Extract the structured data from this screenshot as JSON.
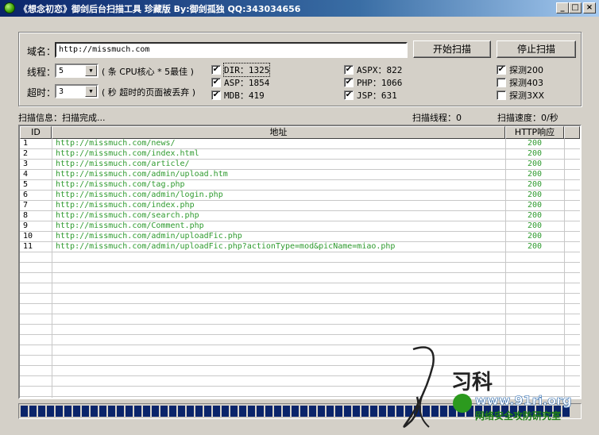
{
  "window": {
    "title": "《想念初恋》御剑后台扫描工具 珍藏版 By:御剑孤独 QQ:343034656",
    "minimize_glyph": "_",
    "maximize_glyph": "□",
    "close_glyph": "×"
  },
  "domain": {
    "label": "域名：",
    "value": "http://missmuch.com"
  },
  "buttons": {
    "start": "开始扫描",
    "stop": "停止扫描"
  },
  "threads": {
    "label": "线程：",
    "value": "5",
    "hint": "( 条 CPU核心 * 5最佳 )"
  },
  "timeout": {
    "label": "超时：",
    "value": "3",
    "hint": "( 秒 超时的页面被丢弃 )"
  },
  "checkboxes": [
    {
      "label": "DIR：1325",
      "checked": true
    },
    {
      "label": "ASP：1854",
      "checked": true
    },
    {
      "label": "MDB：419",
      "checked": true
    },
    {
      "label": "ASPX：822",
      "checked": true
    },
    {
      "label": "PHP：1066",
      "checked": true
    },
    {
      "label": "JSP：631",
      "checked": true
    },
    {
      "label": "探测200",
      "checked": true
    },
    {
      "label": "探测403",
      "checked": false
    },
    {
      "label": "探测3XX",
      "checked": false
    }
  ],
  "status": {
    "info": "扫描信息：扫描完成...",
    "threads": "扫描线程：0",
    "speed": "扫描速度：0/秒"
  },
  "table": {
    "headers": [
      "ID",
      "地址",
      "HTTP响应"
    ],
    "rows": [
      [
        "1",
        "http://missmuch.com/news/",
        "200"
      ],
      [
        "2",
        "http://missmuch.com/index.html",
        "200"
      ],
      [
        "3",
        "http://missmuch.com/article/",
        "200"
      ],
      [
        "4",
        "http://missmuch.com/admin/upload.htm",
        "200"
      ],
      [
        "5",
        "http://missmuch.com/tag.php",
        "200"
      ],
      [
        "6",
        "http://missmuch.com/admin/login.php",
        "200"
      ],
      [
        "7",
        "http://missmuch.com/index.php",
        "200"
      ],
      [
        "8",
        "http://missmuch.com/search.php",
        "200"
      ],
      [
        "9",
        "http://missmuch.com/Comment.php",
        "200"
      ],
      [
        "10",
        "http://missmuch.com/admin/uploadFic.php",
        "200"
      ],
      [
        "11",
        "http://missmuch.com/admin/uploadFic.php?actionType=mod&picName=miao.php",
        "200"
      ]
    ]
  },
  "progress": {
    "value": 1.0
  },
  "watermark": {
    "text1": "习科",
    "text2": "www.91ri.org",
    "text3": "网络安全攻防研究室"
  },
  "colors": {
    "url": "#2e9a2e",
    "titlebar": "#0a246a",
    "progress": "#0a246a"
  },
  "icons": {
    "app": "green-orb-icon"
  }
}
